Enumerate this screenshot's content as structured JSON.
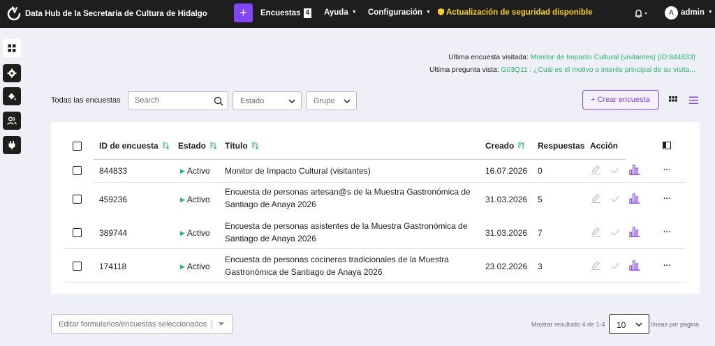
{
  "app": {
    "title": "Data Hub de la Secretaría de Cultura de Hidalgo"
  },
  "topbar": {
    "add_label": "+",
    "surveys_label": "Encuestas",
    "surveys_count": "4",
    "help_label": "Ayuda",
    "config_label": "Configuración",
    "security_label": "Actualización de seguridad disponible",
    "user_initial": "A",
    "user_label": "admin"
  },
  "sidebar": {
    "items": [
      {
        "icon": "dashboard-icon",
        "active": true
      },
      {
        "icon": "gear-icon",
        "active": false
      },
      {
        "icon": "paint-bucket-icon",
        "active": false
      },
      {
        "icon": "users-icon",
        "active": false
      },
      {
        "icon": "plugin-icon",
        "active": false
      }
    ]
  },
  "recent": {
    "survey_label": "Ultima encuesta visitada:",
    "survey_value": "Monitor de Impacto Cultural (visitantes) (ID:844833)",
    "question_label": "Ultima pregunta vista:",
    "question_value": "G03Q11 : ¿Cuál es el motivo o interés principal de su visita..."
  },
  "filters": {
    "all_surveys": "Todas las encuestas",
    "search_placeholder": "Search",
    "status_placeholder": "Estado",
    "group_placeholder": "Grupo",
    "create_label": "+ Crear encuesta"
  },
  "table": {
    "columns": {
      "id": "ID de encuesta",
      "status": "Estado",
      "title": "Título",
      "created": "Creado",
      "responses": "Respuestas",
      "action": "Acción"
    },
    "rows": [
      {
        "id": "844833",
        "status": "Activo",
        "title": "Monitor de Impacto Cultural (visitantes)",
        "created": "16.07.2026",
        "responses": "0"
      },
      {
        "id": "459236",
        "status": "Activo",
        "title": "Encuesta de personas artesan@s de la Muestra Gastronómica de Santiago de Anaya 2026",
        "created": "31.03.2026",
        "responses": "5"
      },
      {
        "id": "389744",
        "status": "Activo",
        "title": "Encuesta de personas asistentes de la Muestra Gastronómica de Santiago de Anaya 2026",
        "created": "31.03.2026",
        "responses": "7"
      },
      {
        "id": "174118",
        "status": "Activo",
        "title": "Encuesta de personas cocineras tradicionales de la Muestra Gastronómica de Santiago de Anaya 2026",
        "created": "23.02.2026",
        "responses": "3"
      }
    ],
    "more_label": "···"
  },
  "footer": {
    "bulk_label": "Editar formularios/encuestas seleccionados",
    "showing_label": "Mostrar resultado 4 de 1-4",
    "per_page_value": "10",
    "per_page_suffix": "líneas por pagina"
  },
  "colors": {
    "accent": "#8146f6",
    "success": "#26b86f",
    "warning": "#f5d21c",
    "topbar": "#1e1e1e"
  }
}
